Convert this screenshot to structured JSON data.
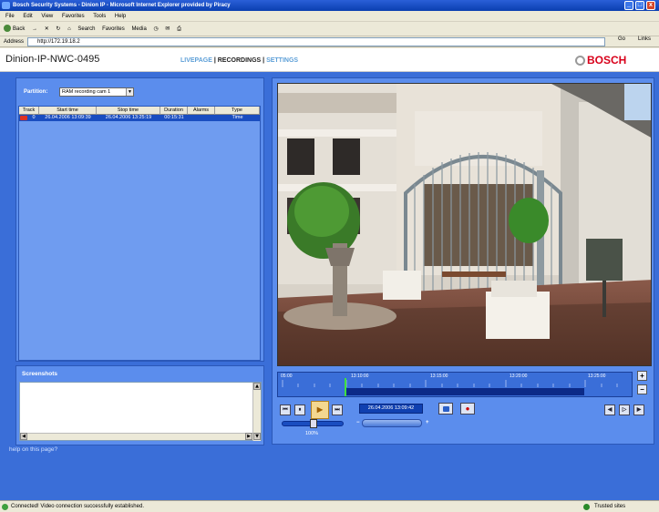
{
  "window": {
    "title": "Bosch Security Systems - Dinion IP - Microsoft Internet Explorer provided by Piracy"
  },
  "menu": [
    "File",
    "Edit",
    "View",
    "Favorites",
    "Tools",
    "Help"
  ],
  "toolbar": {
    "back": "Back",
    "search": "Search",
    "favorites": "Favorites",
    "media": "Media"
  },
  "address": {
    "label": "Address",
    "url": "http://172.19.18.2",
    "go": "Go",
    "links": "Links"
  },
  "header": {
    "device_name": "Dinion-IP-NWC-0495",
    "nav_livepage": "LIVEPAGE",
    "nav_sep1": " | ",
    "nav_recordings": "RECORDINGS",
    "nav_sep2": " | ",
    "nav_settings": "SETTINGS",
    "brand": "BOSCH"
  },
  "partition": {
    "label": "Partition:",
    "selected": "RAM recording cam 1"
  },
  "recordings_table": {
    "columns": [
      "Track",
      "Start time",
      "Stop time",
      "Duration",
      "Alarms",
      "Type"
    ],
    "rows": [
      {
        "track": "0",
        "start": "26.04.2006 13:09:39",
        "stop": "26.04.2006 13:25:19",
        "duration": "00:15:31",
        "alarms": "",
        "type": "Time"
      }
    ]
  },
  "screenshots": {
    "label": "Screenshots"
  },
  "help": {
    "text": "help on this page?"
  },
  "timeline": {
    "ticks": [
      "05:00",
      "13:10:00",
      "13:15:00",
      "13:20:00",
      "13:25:00"
    ]
  },
  "playback": {
    "current_time": "26.04.2006 13:09:42",
    "speed": "100%",
    "zoom_in": "+",
    "zoom_out": "−"
  },
  "status": {
    "text": "Connected! Video connection successfully established.",
    "zone": "Trusted sites"
  }
}
